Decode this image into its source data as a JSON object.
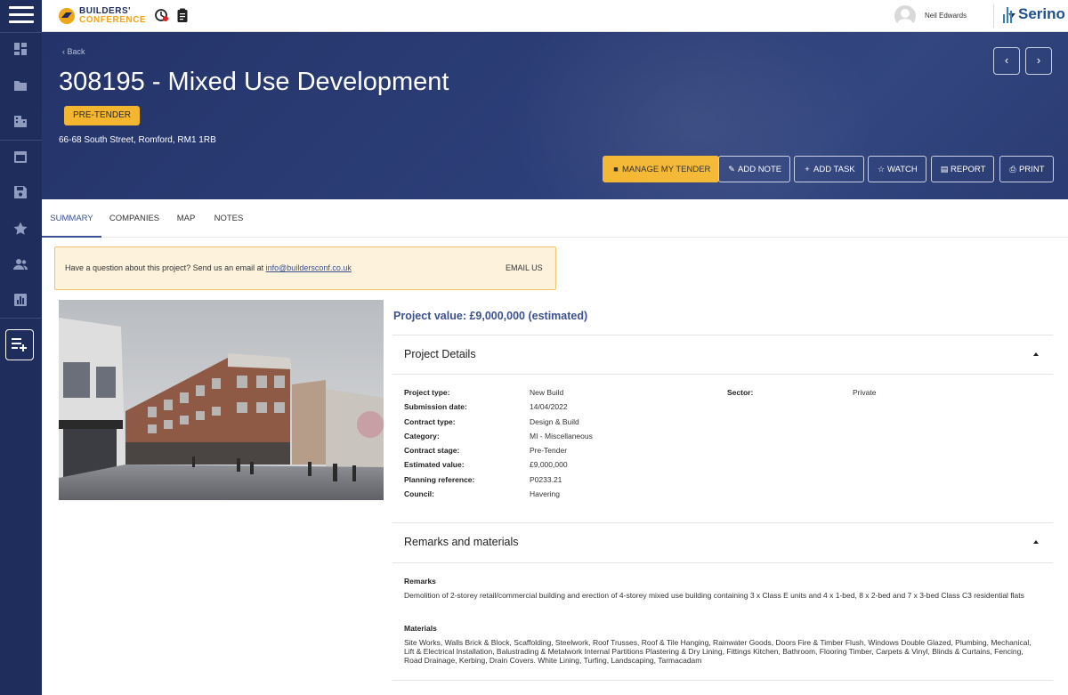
{
  "app": {
    "logo_line1": "BUILDERS'",
    "logo_line2": "CONFERENCE",
    "brand_right": "Serino",
    "user_name": "Neil Edwards"
  },
  "colors": {
    "navy": "#1e2d5c",
    "accent_yellow": "#f4b62e",
    "link_blue": "#3b5190"
  },
  "sidebar": {
    "icons": [
      "dashboard-icon",
      "folder-icon",
      "building-icon",
      "calendar-icon",
      "save-icon",
      "star-icon",
      "people-icon",
      "report-icon",
      "playlist-add-icon"
    ]
  },
  "header": {
    "back_label": "Back",
    "title": "308195 - Mixed Use Development",
    "status_badge": "PRE-TENDER",
    "address": "66-68 South Street, Romford, RM1 1RB",
    "prev_label": "‹",
    "next_label": "›",
    "actions": {
      "manage": "MANAGE MY TENDER",
      "add_note": "ADD NOTE",
      "add_task": "ADD TASK",
      "watch": "WATCH",
      "report": "REPORT",
      "print": "PRINT"
    }
  },
  "tabs": [
    "SUMMARY",
    "COMPANIES",
    "MAP",
    "NOTES"
  ],
  "notice": {
    "question": "Have a question about this project? Send us an email at ",
    "email": "info@buildersconf.co.uk",
    "cta": "EMAIL US"
  },
  "project_value": "Project value: £9,000,000 (estimated)",
  "details": {
    "heading": "Project Details",
    "left": [
      {
        "label": "Project type:",
        "value": "New Build"
      },
      {
        "label": "Submission date:",
        "value": "14/04/2022"
      },
      {
        "label": "Contract type:",
        "value": "Design & Build"
      },
      {
        "label": "Category:",
        "value": "MI - Miscellaneous"
      },
      {
        "label": "Contract stage:",
        "value": "Pre-Tender"
      },
      {
        "label": "Estimated value:",
        "value": "£9,000,000"
      },
      {
        "label": "Planning reference:",
        "value": "P0233.21"
      },
      {
        "label": "Council:",
        "value": "Havering"
      }
    ],
    "right": [
      {
        "label": "Sector:",
        "value": "Private"
      }
    ]
  },
  "remarks_section": {
    "heading": "Remarks and materials",
    "remarks_label": "Remarks",
    "remarks_text": "Demolition of 2-storey retail/commercial building and erection of 4-storey mixed use building containing 3 x Class E units and 4 x 1-bed, 8 x 2-bed and 7 x 3-bed Class C3 residential flats",
    "materials_label": "Materials",
    "materials_text": "Site Works, Walls Brick & Block, Scaffolding, Steelwork, Roof Trusses, Roof & Tile Hanging, Rainwater Goods, Doors Fire & Timber Flush, Windows Double Glazed, Plumbing, Mechanical, Lift & Electrical Installation, Balustrading & Metalwork Internal Partitions Plastering & Dry Lining, Fittings Kitchen, Bathroom, Flooring Timber, Carpets & Vinyl, Blinds & Curtains, Fencing, Road Drainage, Kerbing, Drain Covers. White Lining, Turfing, Landscaping, Tarmacadam"
  }
}
